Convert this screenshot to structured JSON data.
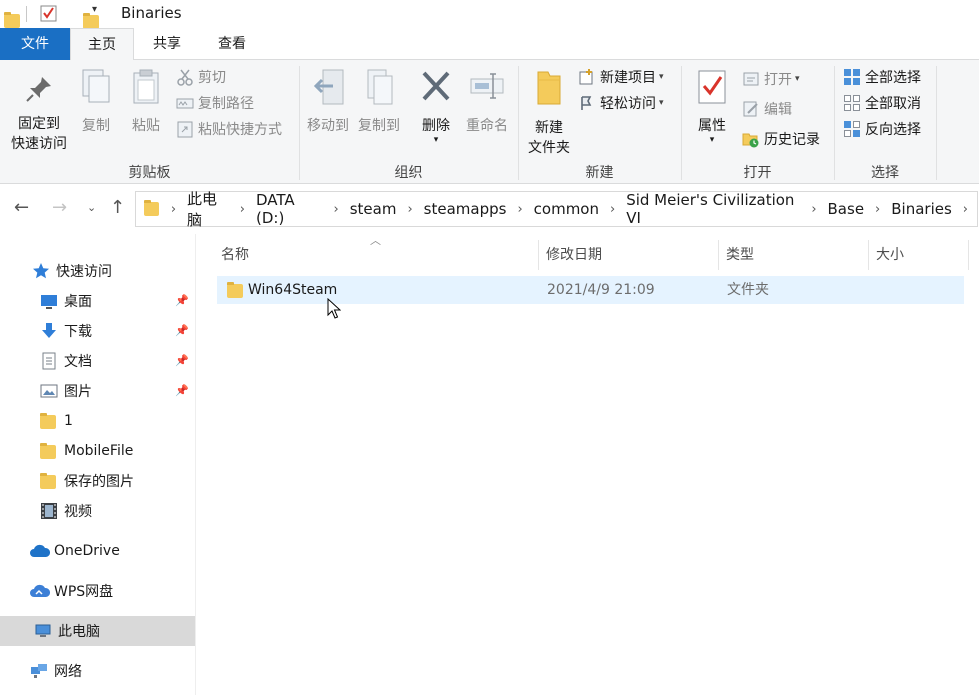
{
  "window": {
    "title": "Binaries"
  },
  "tabs": [
    {
      "label": "文件"
    },
    {
      "label": "主页"
    },
    {
      "label": "共享"
    },
    {
      "label": "查看"
    }
  ],
  "ribbon": {
    "clipboard": {
      "group_label": "剪贴板",
      "pin_quick_access": "固定到\n快速访问",
      "pin_line1": "固定到",
      "pin_line2": "快速访问",
      "copy": "复制",
      "paste": "粘贴",
      "cut": "剪切",
      "copy_path": "复制路径",
      "paste_shortcut": "粘贴快捷方式"
    },
    "organize": {
      "group_label": "组织",
      "move_to": "移动到",
      "copy_to": "复制到",
      "delete": "删除",
      "rename": "重命名"
    },
    "new": {
      "group_label": "新建",
      "new_folder_line1": "新建",
      "new_folder_line2": "文件夹",
      "new_item": "新建项目",
      "easy_access": "轻松访问"
    },
    "open": {
      "group_label": "打开",
      "properties": "属性",
      "open": "打开",
      "edit": "编辑",
      "history": "历史记录"
    },
    "select": {
      "group_label": "选择",
      "select_all": "全部选择",
      "select_none": "全部取消",
      "invert": "反向选择"
    }
  },
  "address": {
    "breadcrumbs": [
      "此电脑",
      "DATA (D:)",
      "steam",
      "steamapps",
      "common",
      "Sid Meier's Civilization VI",
      "Base",
      "Binaries"
    ]
  },
  "sidebar": {
    "items": [
      {
        "label": "快速访问",
        "icon": "star-icon"
      },
      {
        "label": "桌面",
        "icon": "desktop-icon",
        "pinned": true
      },
      {
        "label": "下载",
        "icon": "download-icon",
        "pinned": true
      },
      {
        "label": "文档",
        "icon": "document-icon",
        "pinned": true
      },
      {
        "label": "图片",
        "icon": "pictures-icon",
        "pinned": true
      },
      {
        "label": "1",
        "icon": "folder-icon"
      },
      {
        "label": "MobileFile",
        "icon": "folder-icon"
      },
      {
        "label": "保存的图片",
        "icon": "folder-icon"
      },
      {
        "label": "视频",
        "icon": "video-icon"
      },
      {
        "label": "OneDrive",
        "icon": "cloud-icon"
      },
      {
        "label": "WPS网盘",
        "icon": "cloud-icon"
      },
      {
        "label": "此电脑",
        "icon": "computer-icon",
        "selected": true
      },
      {
        "label": "网络",
        "icon": "network-icon"
      }
    ]
  },
  "columns": {
    "name": "名称",
    "modified": "修改日期",
    "type": "类型",
    "size": "大小"
  },
  "files": [
    {
      "name": "Win64Steam",
      "modified": "2021/4/9 21:09",
      "type": "文件夹",
      "size": ""
    }
  ],
  "colors": {
    "accent": "#1a6fc4",
    "selection": "#e5f3ff",
    "folder": "#f4cb5b"
  }
}
